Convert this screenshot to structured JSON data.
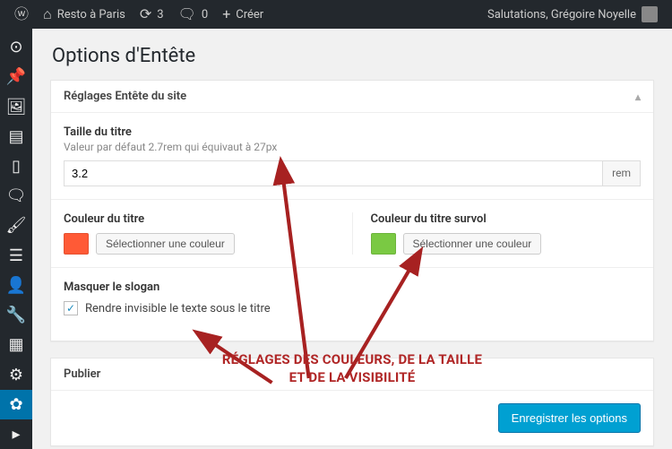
{
  "adminbar": {
    "site_name": "Resto à Paris",
    "updates_count": "3",
    "comments_count": "0",
    "create_label": "Créer",
    "greeting": "Salutations, Grégoire Noyelle"
  },
  "sidebar_icons": [
    "dashboard",
    "pin",
    "media",
    "pages",
    "book",
    "comments",
    "divider",
    "brush",
    "list",
    "user",
    "tools",
    "grid",
    "settings",
    "gear",
    "triangle"
  ],
  "page": {
    "title": "Options d'Entête"
  },
  "panel_settings": {
    "title": "Réglages Entête du site",
    "title_size": {
      "label": "Taille du titre",
      "desc": "Valeur par défaut 2.7rem qui équivaut à 27px",
      "value": "3.2",
      "unit": "rem"
    },
    "title_color": {
      "label": "Couleur du titre",
      "button": "Sélectionner une couleur",
      "swatch": "#ff5a36"
    },
    "title_hover_color": {
      "label": "Couleur du titre survol",
      "button": "Sélectionner une couleur",
      "swatch": "#7ac943"
    },
    "hide_tagline": {
      "label": "Masquer le slogan",
      "checkbox_label": "Rendre invisible le texte sous le titre",
      "checked": true
    }
  },
  "panel_publish": {
    "title": "Publier",
    "save_button": "Enregistrer les options"
  },
  "annotation": {
    "line1": "RÉGLAGES DES COULEURS, DE LA TAILLE",
    "line2": "ET DE LA VISIBILITÉ"
  }
}
